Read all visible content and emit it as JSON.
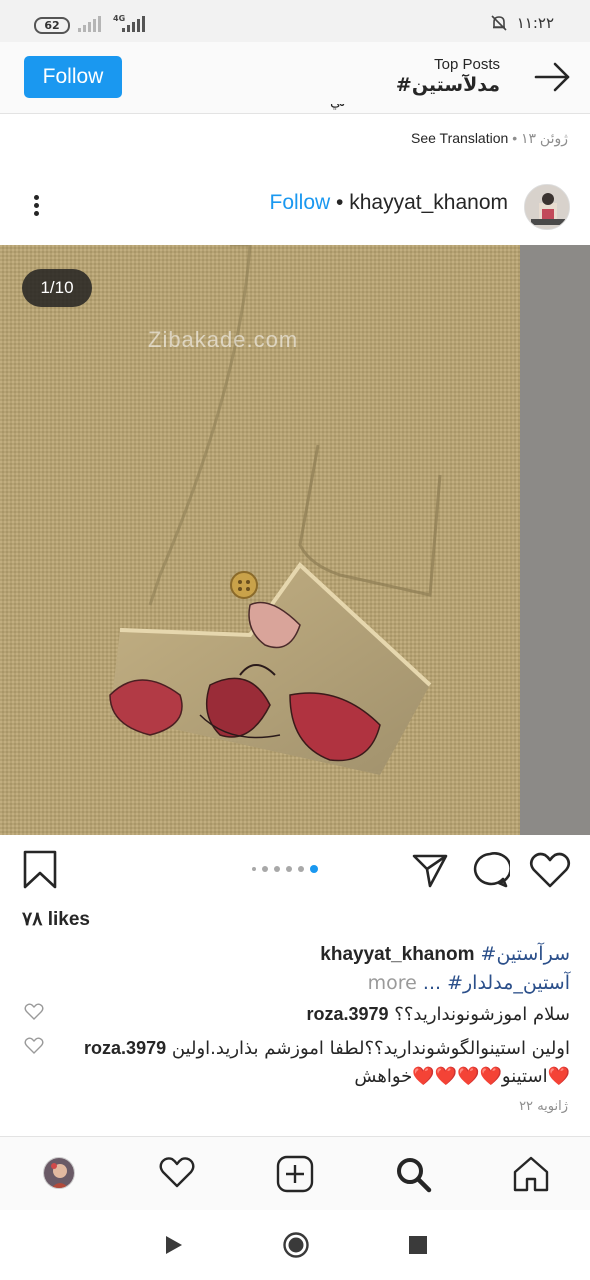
{
  "status_bar": {
    "battery": "62",
    "network": "4G",
    "time": "١١:٢٢"
  },
  "header": {
    "follow_label": "Follow",
    "subtitle": "Top Posts",
    "title": "#مدلآستین",
    "back_icon": "arrow-right-icon"
  },
  "previous_post": {
    "caption_fragment": "ني",
    "date": "۱۳ ژوئن",
    "separator": "•",
    "translate_label": "See Translation"
  },
  "post": {
    "follow_label": "Follow",
    "separator": "•",
    "username": "khayyat_khanom",
    "image_counter": "1/10",
    "watermark": "Zibakade.com",
    "carousel": {
      "total_dots": 6,
      "active_index": 5
    },
    "likes": "۷۸ likes",
    "caption": {
      "username": "khayyat_khanom",
      "line1_tag": "#سرآستین",
      "line2_tag": "#آستین_مدلدار",
      "line2_ellipsis": "...",
      "more_label": "more"
    },
    "comments": [
      {
        "username": "roza.3979",
        "text": "سلام اموزشونونداريد؟؟"
      },
      {
        "username": "roza.3979",
        "text": "اولين استينوالگوشونداريد؟؟لطفا اموزشم بذاريد.اولين استينو❤️❤️❤️❤️خواهش❤️"
      }
    ],
    "date": "۲۲ ژانویه"
  },
  "icons": {
    "bookmark": "bookmark-icon",
    "share": "share-icon",
    "comment": "comment-icon",
    "like": "heart-icon",
    "more": "more-options-icon"
  },
  "bottom_nav": [
    "profile-avatar",
    "activity-heart-icon",
    "new-post-icon",
    "search-icon",
    "home-icon"
  ],
  "colors": {
    "accent": "#1a98f0",
    "hashtag": "#2b4f8a",
    "fabric": "#b8a575"
  }
}
